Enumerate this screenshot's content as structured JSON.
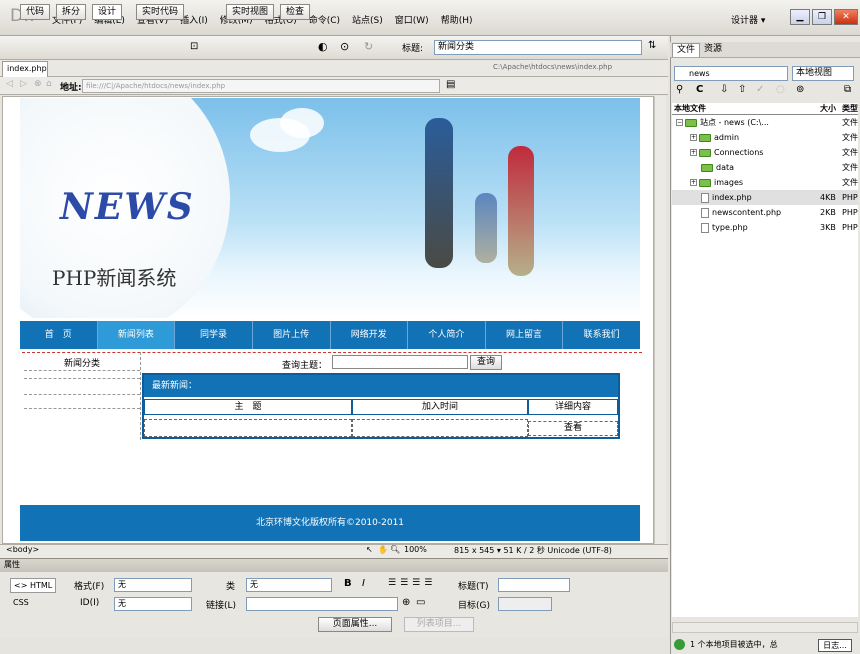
{
  "app": {
    "logo": "Dw",
    "menu": [
      "文件(F)",
      "编辑(E)",
      "查看(V)",
      "插入(I)",
      "修改(M)",
      "格式(O)",
      "命令(C)",
      "站点(S)",
      "窗口(W)",
      "帮助(H)"
    ],
    "workspace": "设计器 ▾"
  },
  "toolbar": {
    "code": "代码",
    "split": "拆分",
    "design": "设计",
    "live_code": "实时代码",
    "live_view": "实时视图",
    "inspect": "检查",
    "title_label": "标题:",
    "title_value": "新闻分类"
  },
  "document": {
    "tab": "index.php ×",
    "path": "C:\\Apache\\htdocs\\news\\index.php",
    "address_label": "地址:",
    "address_value": "file:///C|/Apache/htdocs/news/index.php"
  },
  "page": {
    "logo": "NEWS",
    "system_title": "PHP新闻系统",
    "nav": [
      "首　页",
      "新闻列表",
      "同学录",
      "图片上传",
      "网络开发",
      "个人简介",
      "网上留言",
      "联系我们"
    ],
    "active_nav": 1,
    "category_label": "新闻分类",
    "search_label": "查询主题：",
    "search_button": "查询",
    "latest_news": "最新新闻：",
    "columns": [
      "主　题",
      "加入时间",
      "详细内容"
    ],
    "view_link": "查看",
    "footer": "北京环博文化版权所有©2010-2011"
  },
  "statusbar": {
    "tag": "<body>",
    "zoom": "100%",
    "info": "815 x 545 ▾ 51 K / 2 秒  Unicode (UTF-8)"
  },
  "properties": {
    "title": "属性",
    "html_btn": "<> HTML",
    "css_btn": "CSS",
    "format_label": "格式(F)",
    "format_value": "无",
    "class_label": "类",
    "class_value": "无",
    "bold": "B",
    "italic": "I",
    "title_label": "标题(T)",
    "id_label": "ID(I)",
    "id_value": "无",
    "link_label": "链接(L)",
    "target_label": "目标(G)",
    "page_props": "页面属性...",
    "list_item": "列表项目..."
  },
  "files_panel": {
    "tabs": [
      "文件",
      "资源"
    ],
    "site": "news",
    "view": "本地视图",
    "header_local": "本地文件",
    "header_size": "大小",
    "header_type": "类型",
    "items": [
      {
        "name": "站点 - news (C:\\...",
        "size": "",
        "type": "文件",
        "kind": "root"
      },
      {
        "name": "admin",
        "size": "",
        "type": "文件",
        "kind": "folder"
      },
      {
        "name": "Connections",
        "size": "",
        "type": "文件",
        "kind": "folder"
      },
      {
        "name": "data",
        "size": "",
        "type": "文件",
        "kind": "folder"
      },
      {
        "name": "images",
        "size": "",
        "type": "文件",
        "kind": "folder"
      },
      {
        "name": "index.php",
        "size": "4KB",
        "type": "PHP",
        "kind": "file"
      },
      {
        "name": "newscontent.php",
        "size": "2KB",
        "type": "PHP",
        "kind": "file"
      },
      {
        "name": "type.php",
        "size": "3KB",
        "type": "PHP",
        "kind": "file"
      }
    ],
    "status": "1 个本地项目被选中，总",
    "log_btn": "日志..."
  }
}
